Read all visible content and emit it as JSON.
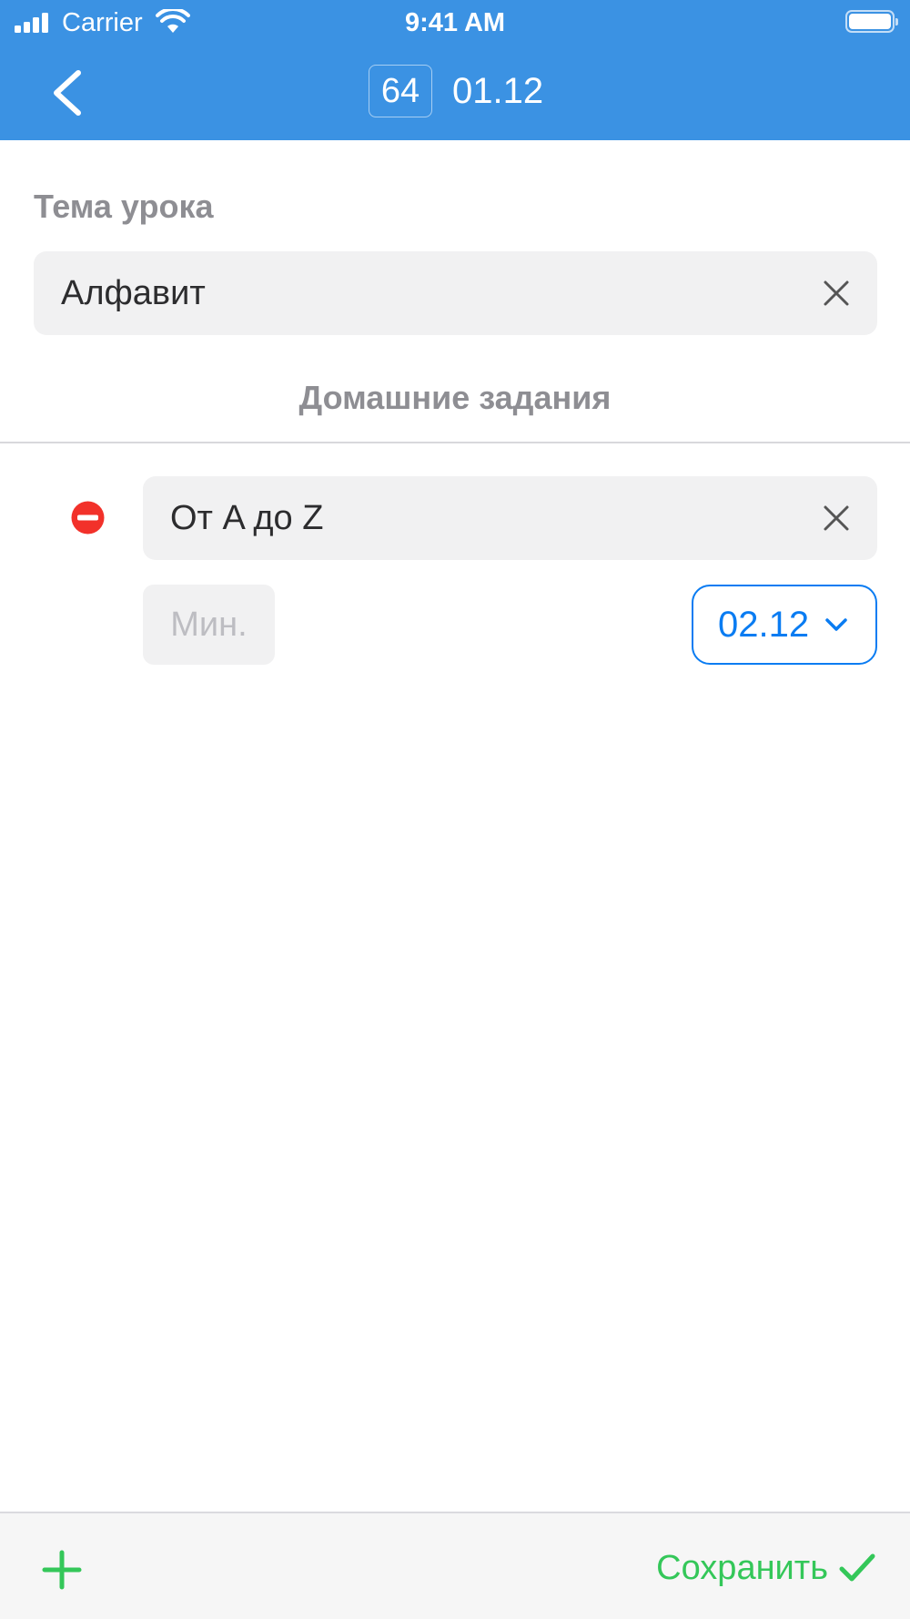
{
  "status_bar": {
    "carrier": "Carrier",
    "time": "9:41 AM"
  },
  "header": {
    "lesson_number": "64",
    "date": "01.12",
    "background_color": "#3b92e3"
  },
  "topic": {
    "label": "Тема урока",
    "value": "Алфавит"
  },
  "homework": {
    "section_title": "Домашние задания",
    "items": [
      {
        "text": "От A до Z",
        "minutes_placeholder": "Мин.",
        "due_date": "02.12"
      }
    ]
  },
  "bottom_bar": {
    "save_label": "Сохранить",
    "accent_color": "#34c759"
  },
  "icons": {
    "back": "chevron-left-icon",
    "clear": "close-icon",
    "remove": "minus-circle-icon",
    "dropdown": "chevron-down-icon",
    "add": "plus-icon",
    "save": "checkmark-icon"
  }
}
